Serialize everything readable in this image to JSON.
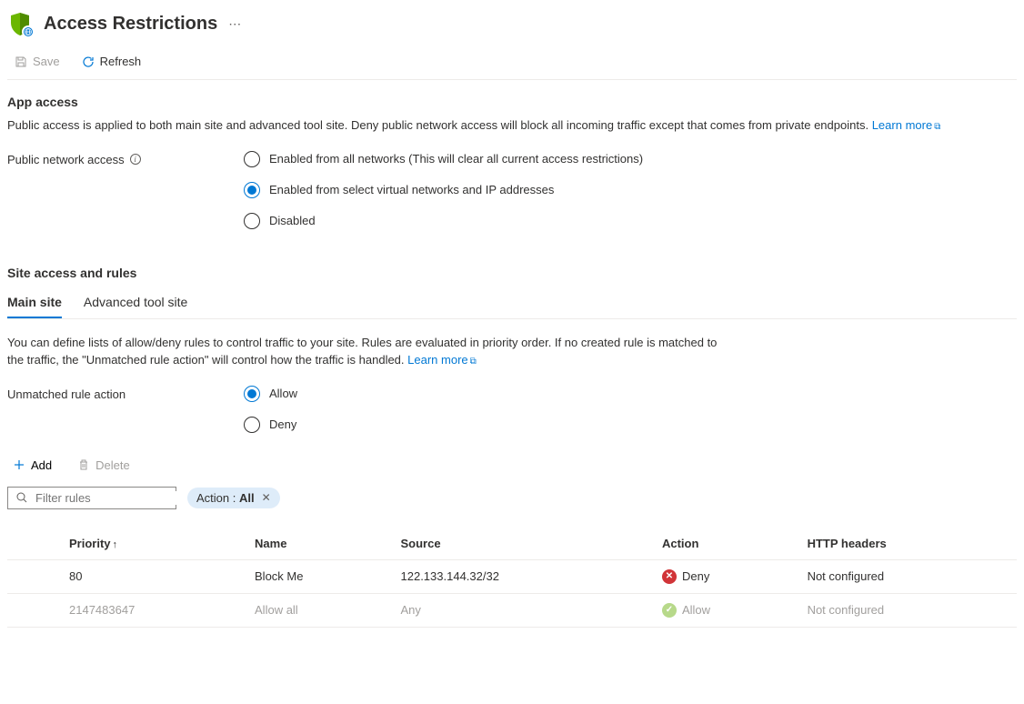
{
  "header": {
    "title": "Access Restrictions"
  },
  "toolbar": {
    "save_label": "Save",
    "refresh_label": "Refresh"
  },
  "app_access": {
    "title": "App access",
    "description": "Public access is applied to both main site and advanced tool site. Deny public network access will block all incoming traffic except that comes from private endpoints.",
    "learn_more": "Learn more",
    "field_label": "Public network access",
    "options": {
      "enabled_all": "Enabled from all networks (This will clear all current access restrictions)",
      "enabled_select": "Enabled from select virtual networks and IP addresses",
      "disabled": "Disabled"
    },
    "selected": "enabled_select"
  },
  "site_rules": {
    "title": "Site access and rules",
    "tabs": {
      "main": "Main site",
      "advanced": "Advanced tool site"
    },
    "active_tab": "main",
    "description": "You can define lists of allow/deny rules to control traffic to your site. Rules are evaluated in priority order. If no created rule is matched to the traffic, the \"Unmatched rule action\" will control how the traffic is handled.",
    "learn_more": "Learn more",
    "unmatched_label": "Unmatched rule action",
    "unmatched_options": {
      "allow": "Allow",
      "deny": "Deny"
    },
    "unmatched_selected": "allow"
  },
  "rules_bar": {
    "add_label": "Add",
    "delete_label": "Delete",
    "filter_placeholder": "Filter rules",
    "pill_prefix": "Action :",
    "pill_value": "All"
  },
  "table": {
    "columns": {
      "priority": "Priority",
      "name": "Name",
      "source": "Source",
      "action": "Action",
      "headers": "HTTP headers"
    },
    "rows": [
      {
        "priority": "80",
        "name": "Block Me",
        "source": "122.133.144.32/32",
        "action": "Deny",
        "headers": "Not configured",
        "muted": false
      },
      {
        "priority": "2147483647",
        "name": "Allow all",
        "source": "Any",
        "action": "Allow",
        "headers": "Not configured",
        "muted": true
      }
    ]
  }
}
